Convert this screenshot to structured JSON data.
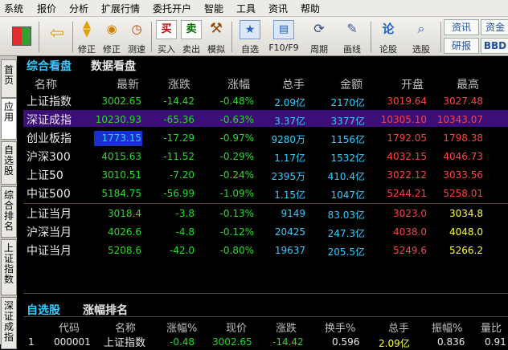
{
  "menu": [
    "系统",
    "报价",
    "分析",
    "扩展行情",
    "委托开户",
    "智能",
    "工具",
    "资讯",
    "帮助"
  ],
  "toolbar": {
    "buttons": [
      {
        "label": "",
        "icon": "grid-icon"
      },
      {
        "label": "",
        "icon": "back-arrow-icon"
      },
      {
        "label": "修正",
        "icon": "up-down-arrow-icon"
      },
      {
        "label": "修正",
        "icon": "coin-icon"
      },
      {
        "label": "测速",
        "icon": "clock-icon"
      },
      {
        "label": "买入",
        "icon": "buy-icon",
        "glyph": "买"
      },
      {
        "label": "卖出",
        "icon": "sell-icon",
        "glyph": "卖"
      },
      {
        "label": "模拟",
        "icon": "hammer-icon"
      },
      {
        "label": "自选",
        "icon": "star-icon"
      },
      {
        "label": "F10/F9",
        "icon": "f10-icon"
      },
      {
        "label": "周期",
        "icon": "period-icon"
      },
      {
        "label": "画线",
        "icon": "pencil-icon"
      },
      {
        "label": "论股",
        "icon": "chat-icon",
        "glyph": "论"
      },
      {
        "label": "选股",
        "icon": "search-icon"
      }
    ],
    "right_links": [
      "资讯",
      "研报",
      "资金",
      "BBD"
    ]
  },
  "sidebar": [
    "首页",
    "应用",
    "自选股",
    "综合排名",
    "上证指数",
    "深证成指"
  ],
  "panel": {
    "tabs": [
      "综合看盘",
      "数据看盘"
    ],
    "headers": [
      "名称",
      "最新",
      "涨跌",
      "涨幅",
      "总手",
      "金额",
      "开盘",
      "最高"
    ],
    "rows": [
      {
        "name": "上证指数",
        "last": "3002.65",
        "chg": "-14.42",
        "pct": "-0.48%",
        "vol": "2.09亿",
        "amt": "2170亿",
        "open": "3019.64",
        "high": "3027.48"
      },
      {
        "name": "深证成指",
        "last": "10230.93",
        "chg": "-65.36",
        "pct": "-0.63%",
        "vol": "3.37亿",
        "amt": "3377亿",
        "open": "10305.10",
        "high": "10343.07"
      },
      {
        "name": "创业板指",
        "last": "1773.15",
        "chg": "-17.29",
        "pct": "-0.97%",
        "vol": "9280万",
        "amt": "1156亿",
        "open": "1792.05",
        "high": "1798.38"
      },
      {
        "name": "沪深300",
        "last": "4015.63",
        "chg": "-11.52",
        "pct": "-0.29%",
        "vol": "1.17亿",
        "amt": "1532亿",
        "open": "4032.15",
        "high": "4046.73"
      },
      {
        "name": "上证50",
        "last": "3010.51",
        "chg": "-7.20",
        "pct": "-0.24%",
        "vol": "2395万",
        "amt": "410.4亿",
        "open": "3022.12",
        "high": "3033.56"
      },
      {
        "name": "中证500",
        "last": "5184.75",
        "chg": "-56.99",
        "pct": "-1.09%",
        "vol": "1.15亿",
        "amt": "1047亿",
        "open": "5244.21",
        "high": "5258.01"
      },
      {
        "name": "上证当月",
        "last": "3018.4",
        "chg": "-3.8",
        "pct": "-0.13%",
        "vol": "9149",
        "amt": "83.03亿",
        "open": "3023.0",
        "high": "3034.8"
      },
      {
        "name": "沪深当月",
        "last": "4026.6",
        "chg": "-4.8",
        "pct": "-0.12%",
        "vol": "20425",
        "amt": "247.3亿",
        "open": "4038.0",
        "high": "4048.0"
      },
      {
        "name": "中证当月",
        "last": "5208.6",
        "chg": "-42.0",
        "pct": "-0.80%",
        "vol": "19637",
        "amt": "205.5亿",
        "open": "5249.6",
        "high": "5266.2"
      }
    ]
  },
  "watchlist": {
    "tabs": [
      "自选股",
      "涨幅排名"
    ],
    "headers": [
      "代码",
      "名称",
      "涨幅%",
      "现价",
      "涨跌",
      "换手%",
      "总手",
      "振幅%",
      "量比"
    ],
    "row": {
      "idx": "1",
      "code": "000001",
      "name": "上证指数",
      "pct": "-0.48",
      "price": "3002.65",
      "chg": "-14.42",
      "turn": "0.596",
      "vol": "2.09亿",
      "amp": "0.836",
      "ratio": "0.91"
    }
  },
  "colors": {
    "green": "#22dd22",
    "red": "#ff4040",
    "cyan": "#33ccff",
    "yellow": "#ffff33",
    "white": "#e8e8e8",
    "highlight": "#3c0f78"
  }
}
